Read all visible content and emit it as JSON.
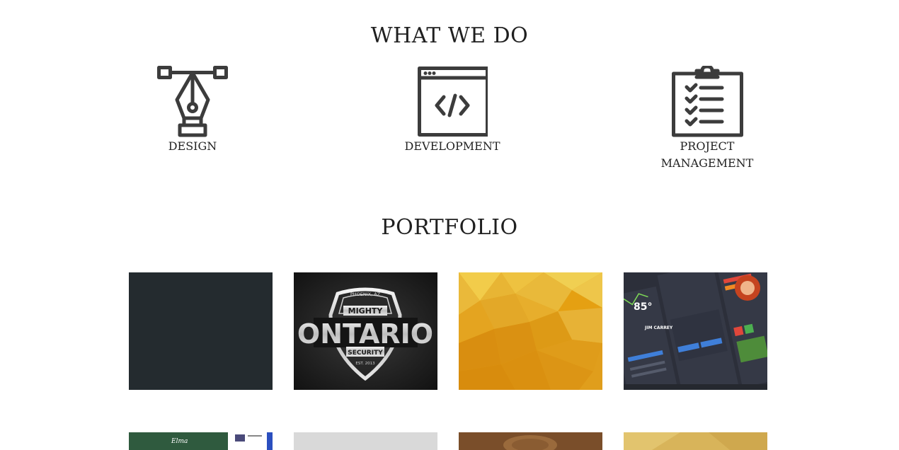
{
  "what_we_do": {
    "title": "WHAT WE DO",
    "services": [
      {
        "label": "DESIGN",
        "icon": "pen-tool-icon"
      },
      {
        "label": "DEVELOPMENT",
        "icon": "code-window-icon"
      },
      {
        "label": "PROJECT MANAGEMENT",
        "icon": "clipboard-checklist-icon"
      }
    ]
  },
  "portfolio": {
    "title": "PORTFOLIO",
    "items": [
      {
        "name": "dark-slate",
        "color": "#242b2f"
      },
      {
        "name": "mighty-ontario-logo",
        "logo_text_top": "PHOENIX, AZ",
        "logo_text_mid": "MIGHTY",
        "logo_text_main": "ONTARIO",
        "logo_text_sub": "SECURITY",
        "logo_text_est": "EST. 2013"
      },
      {
        "name": "yellow-polygon",
        "color": "#e5a012"
      },
      {
        "name": "dashboard-ui-kit",
        "weather": "85°",
        "name_label": "JIM CARREY"
      },
      {
        "name": "website-preview",
        "title": "Elma"
      },
      {
        "name": "gray-preview"
      },
      {
        "name": "wood-preview"
      },
      {
        "name": "gold-paper-preview"
      }
    ]
  },
  "colors": {
    "icon_stroke": "#3c3c3c",
    "text": "#222222"
  }
}
